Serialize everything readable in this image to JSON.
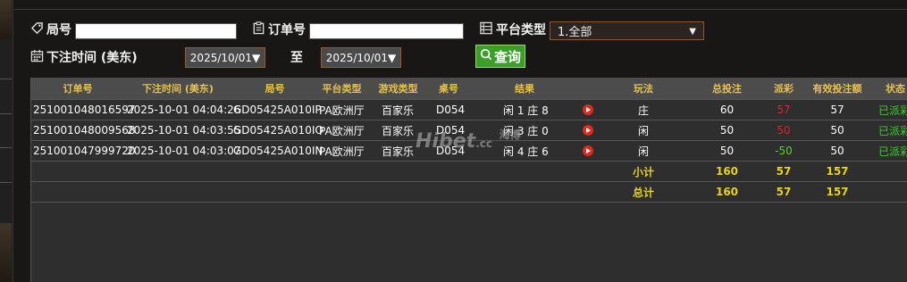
{
  "filters": {
    "round_label": "局号",
    "round_value": "",
    "order_label": "订单号",
    "order_value": "",
    "platform_label": "平台类型",
    "platform_selected": "1.全部",
    "time_label": "下注时间 (美东)",
    "date_from": "2025/10/01▼",
    "to_label": "至",
    "date_to": "2025/10/01▼",
    "query_label": "查询"
  },
  "table": {
    "headers": [
      "订单号",
      "下注时间 (美东)",
      "局号",
      "平台类型",
      "游戏类型",
      "桌号",
      "结果",
      "",
      "玩法",
      "总投注",
      "派彩",
      "有效投注额",
      "状态"
    ],
    "rows": [
      {
        "order": "251001048016597",
        "time": "2025-10-01 04:04:26",
        "round": "GD05425A010IP",
        "platform": "PA欧洲厅",
        "game": "百家乐",
        "table": "D054",
        "result": "闲 1 庄 8",
        "bet": "庄",
        "total": "60",
        "payout": "57",
        "valid": "57",
        "status": "已派彩"
      },
      {
        "order": "251001048009568",
        "time": "2025-10-01 04:03:55",
        "round": "GD05425A010IO",
        "platform": "PA欧洲厅",
        "game": "百家乐",
        "table": "D054",
        "result": "闲 3 庄 0",
        "bet": "闲",
        "total": "50",
        "payout": "50",
        "valid": "50",
        "status": "已派彩"
      },
      {
        "order": "251001047999720",
        "time": "2025-10-01 04:03:07",
        "round": "GD05425A010IN",
        "platform": "PA欧洲厅",
        "game": "百家乐",
        "table": "D054",
        "result": "闲 4 庄 6",
        "bet": "闲",
        "total": "50",
        "payout": "-50",
        "valid": "50",
        "status": "已派彩"
      }
    ],
    "subtotal": {
      "label": "小计",
      "total": "160",
      "payout": "57",
      "valid": "157"
    },
    "grand_total": {
      "label": "总计",
      "total": "160",
      "payout": "57",
      "valid": "157"
    }
  },
  "watermark": {
    "brand": "Hibet",
    "domain": ".cc",
    "cn": "海博"
  },
  "colors": {
    "accent": "#e8c24a",
    "win": "#d02a2a",
    "loss": "#5ad02a",
    "status": "#3ad02a",
    "query_button": "#3d9d2a"
  },
  "icons": {
    "round": "tag-icon",
    "order": "clipboard-icon",
    "platform": "list-icon",
    "time": "calendar-icon",
    "query": "search-icon",
    "play": "play-icon"
  }
}
